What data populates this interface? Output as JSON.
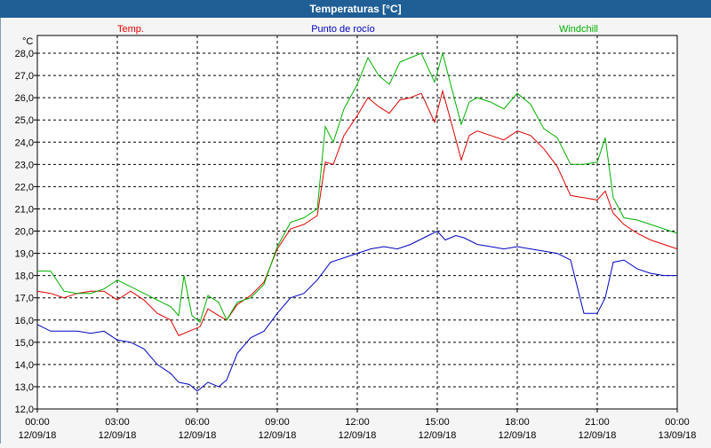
{
  "window": {
    "title": "Temperaturas [°C]"
  },
  "chart_data": {
    "type": "line",
    "title": "Temperaturas [°C]",
    "y_unit_label": "°C",
    "ylim": [
      12.0,
      28.5
    ],
    "y_ticks": [
      "12,0",
      "13,0",
      "14,0",
      "15,0",
      "16,0",
      "17,0",
      "18,0",
      "19,0",
      "20,0",
      "21,0",
      "22,0",
      "23,0",
      "24,0",
      "25,0",
      "26,0",
      "27,0",
      "28,0"
    ],
    "y_tick_values": [
      12,
      13,
      14,
      15,
      16,
      17,
      18,
      19,
      20,
      21,
      22,
      23,
      24,
      25,
      26,
      27,
      28
    ],
    "x_ticks": [
      {
        "time": "00:00",
        "date": "12/09/18",
        "hour": 0
      },
      {
        "time": "03:00",
        "date": "12/09/18",
        "hour": 3
      },
      {
        "time": "06:00",
        "date": "12/09/18",
        "hour": 6
      },
      {
        "time": "09:00",
        "date": "12/09/18",
        "hour": 9
      },
      {
        "time": "12:00",
        "date": "12/09/18",
        "hour": 12
      },
      {
        "time": "15:00",
        "date": "12/09/18",
        "hour": 15
      },
      {
        "time": "18:00",
        "date": "12/09/18",
        "hour": 18
      },
      {
        "time": "21:00",
        "date": "12/09/18",
        "hour": 21
      },
      {
        "time": "00:00",
        "date": "13/09/18",
        "hour": 24
      }
    ],
    "grid": true,
    "series": [
      {
        "name": "Temp.",
        "color": "#e00000",
        "points": [
          [
            0,
            17.3
          ],
          [
            0.5,
            17.2
          ],
          [
            1,
            17.0
          ],
          [
            1.5,
            17.2
          ],
          [
            2,
            17.3
          ],
          [
            2.5,
            17.3
          ],
          [
            3,
            16.9
          ],
          [
            3.5,
            17.3
          ],
          [
            4,
            16.9
          ],
          [
            4.5,
            16.3
          ],
          [
            5,
            16.0
          ],
          [
            5.3,
            15.3
          ],
          [
            5.7,
            15.5
          ],
          [
            6.1,
            15.7
          ],
          [
            6.4,
            16.5
          ],
          [
            6.8,
            16.2
          ],
          [
            7.1,
            16.0
          ],
          [
            7.5,
            16.7
          ],
          [
            8,
            17.1
          ],
          [
            8.5,
            17.7
          ],
          [
            9,
            19.2
          ],
          [
            9.5,
            20.1
          ],
          [
            10,
            20.3
          ],
          [
            10.5,
            20.7
          ],
          [
            10.8,
            23.1
          ],
          [
            11.1,
            23.0
          ],
          [
            11.5,
            24.3
          ],
          [
            12,
            25.2
          ],
          [
            12.4,
            26.0
          ],
          [
            12.8,
            25.6
          ],
          [
            13.2,
            25.3
          ],
          [
            13.6,
            25.9
          ],
          [
            14,
            26.0
          ],
          [
            14.4,
            26.2
          ],
          [
            14.9,
            24.9
          ],
          [
            15.2,
            26.3
          ],
          [
            15.5,
            25.0
          ],
          [
            15.9,
            23.2
          ],
          [
            16.2,
            24.3
          ],
          [
            16.5,
            24.5
          ],
          [
            17,
            24.3
          ],
          [
            17.5,
            24.1
          ],
          [
            18,
            24.5
          ],
          [
            18.5,
            24.3
          ],
          [
            19,
            23.7
          ],
          [
            19.5,
            22.9
          ],
          [
            20,
            21.6
          ],
          [
            20.5,
            21.5
          ],
          [
            21,
            21.4
          ],
          [
            21.3,
            21.8
          ],
          [
            21.6,
            20.8
          ],
          [
            22,
            20.3
          ],
          [
            22.5,
            19.9
          ],
          [
            23,
            19.6
          ],
          [
            23.5,
            19.4
          ],
          [
            24,
            19.2
          ]
        ]
      },
      {
        "name": "Punto de rocío",
        "color": "#0000c0",
        "points": [
          [
            0,
            15.8
          ],
          [
            0.5,
            15.5
          ],
          [
            1,
            15.5
          ],
          [
            1.5,
            15.5
          ],
          [
            2,
            15.4
          ],
          [
            2.5,
            15.5
          ],
          [
            3,
            15.1
          ],
          [
            3.5,
            15.0
          ],
          [
            4,
            14.7
          ],
          [
            4.5,
            14.0
          ],
          [
            5,
            13.6
          ],
          [
            5.3,
            13.2
          ],
          [
            5.7,
            13.1
          ],
          [
            6.0,
            12.8
          ],
          [
            6.4,
            13.2
          ],
          [
            6.8,
            13.0
          ],
          [
            7.1,
            13.3
          ],
          [
            7.5,
            14.5
          ],
          [
            8,
            15.2
          ],
          [
            8.5,
            15.5
          ],
          [
            9,
            16.3
          ],
          [
            9.5,
            17.0
          ],
          [
            10,
            17.2
          ],
          [
            10.5,
            17.8
          ],
          [
            11,
            18.6
          ],
          [
            11.5,
            18.8
          ],
          [
            12,
            19.0
          ],
          [
            12.5,
            19.2
          ],
          [
            13,
            19.3
          ],
          [
            13.5,
            19.2
          ],
          [
            14,
            19.4
          ],
          [
            14.5,
            19.7
          ],
          [
            15,
            20.0
          ],
          [
            15.3,
            19.6
          ],
          [
            15.7,
            19.8
          ],
          [
            16,
            19.7
          ],
          [
            16.5,
            19.4
          ],
          [
            17,
            19.3
          ],
          [
            17.5,
            19.2
          ],
          [
            18,
            19.3
          ],
          [
            18.5,
            19.2
          ],
          [
            19,
            19.1
          ],
          [
            19.5,
            19.0
          ],
          [
            20,
            18.7
          ],
          [
            20.5,
            16.3
          ],
          [
            21,
            16.3
          ],
          [
            21.3,
            17.0
          ],
          [
            21.6,
            18.6
          ],
          [
            22,
            18.7
          ],
          [
            22.5,
            18.3
          ],
          [
            23,
            18.1
          ],
          [
            23.5,
            18.0
          ],
          [
            24,
            18.0
          ]
        ]
      },
      {
        "name": "Windchill",
        "color": "#00b000",
        "points": [
          [
            0,
            18.2
          ],
          [
            0.5,
            18.2
          ],
          [
            1,
            17.3
          ],
          [
            1.5,
            17.2
          ],
          [
            2,
            17.2
          ],
          [
            2.5,
            17.4
          ],
          [
            3,
            17.8
          ],
          [
            3.5,
            17.5
          ],
          [
            4,
            17.2
          ],
          [
            4.5,
            16.9
          ],
          [
            5,
            16.6
          ],
          [
            5.3,
            16.2
          ],
          [
            5.5,
            18.0
          ],
          [
            5.8,
            16.2
          ],
          [
            6.1,
            15.9
          ],
          [
            6.4,
            17.1
          ],
          [
            6.8,
            16.8
          ],
          [
            7.1,
            16.0
          ],
          [
            7.5,
            16.8
          ],
          [
            8,
            17.0
          ],
          [
            8.5,
            17.6
          ],
          [
            9,
            19.3
          ],
          [
            9.5,
            20.4
          ],
          [
            10,
            20.6
          ],
          [
            10.5,
            21.0
          ],
          [
            10.8,
            24.7
          ],
          [
            11.1,
            24.0
          ],
          [
            11.5,
            25.5
          ],
          [
            12,
            26.6
          ],
          [
            12.4,
            27.8
          ],
          [
            12.8,
            27.0
          ],
          [
            13.2,
            26.6
          ],
          [
            13.6,
            27.6
          ],
          [
            14,
            27.8
          ],
          [
            14.4,
            28.0
          ],
          [
            14.9,
            26.7
          ],
          [
            15.2,
            28.0
          ],
          [
            15.5,
            26.6
          ],
          [
            15.9,
            24.8
          ],
          [
            16.2,
            25.8
          ],
          [
            16.5,
            26.0
          ],
          [
            17,
            25.8
          ],
          [
            17.5,
            25.5
          ],
          [
            18,
            26.2
          ],
          [
            18.5,
            25.7
          ],
          [
            19,
            24.6
          ],
          [
            19.5,
            24.2
          ],
          [
            20,
            23.0
          ],
          [
            20.5,
            23.0
          ],
          [
            21,
            23.1
          ],
          [
            21.3,
            24.2
          ],
          [
            21.6,
            21.5
          ],
          [
            22,
            20.6
          ],
          [
            22.5,
            20.5
          ],
          [
            23,
            20.3
          ],
          [
            23.5,
            20.1
          ],
          [
            24,
            19.9
          ]
        ]
      }
    ]
  }
}
